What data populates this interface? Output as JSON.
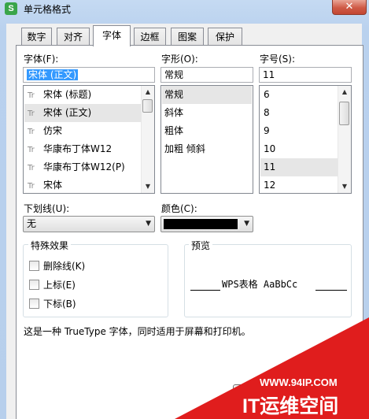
{
  "window": {
    "title": "单元格格式",
    "app_icon": "S",
    "close_glyph": "✕"
  },
  "tabs": [
    {
      "label": "数字",
      "active": false
    },
    {
      "label": "对齐",
      "active": false
    },
    {
      "label": "字体",
      "active": true
    },
    {
      "label": "边框",
      "active": false
    },
    {
      "label": "图案",
      "active": false
    },
    {
      "label": "保护",
      "active": false
    }
  ],
  "font": {
    "label": "字体(F):",
    "value": "宋体 (正文)",
    "items": [
      "宋体 (标题)",
      "宋体 (正文)",
      "仿宋",
      "华康布丁体W12",
      "华康布丁体W12(P)",
      "宋体"
    ],
    "selected_index": 1,
    "item_icon": "truetype-font-icon"
  },
  "style": {
    "label": "字形(O):",
    "value": "常规",
    "items": [
      "常规",
      "斜体",
      "粗体",
      "加粗 倾斜"
    ],
    "selected_index": 0
  },
  "size": {
    "label": "字号(S):",
    "value": "11",
    "items": [
      "6",
      "8",
      "9",
      "10",
      "11",
      "12"
    ],
    "selected_index": 4
  },
  "underline": {
    "label": "下划线(U):",
    "value": "无"
  },
  "color": {
    "label": "颜色(C):",
    "value_color": "#000000"
  },
  "effects": {
    "legend": "特殊效果",
    "items": [
      {
        "label": "删除线(K)",
        "checked": false
      },
      {
        "label": "上标(E)",
        "checked": false
      },
      {
        "label": "下标(B)",
        "checked": false
      }
    ]
  },
  "preview": {
    "legend": "预览",
    "text": "WPS表格  AaBbCc"
  },
  "info_text": "这是一种 TrueType 字体，同时适用于屏幕和打印机。",
  "watermark": {
    "url": "WWW.94IP.COM",
    "name": "IT运维空间",
    "color": "#e01d1d"
  }
}
